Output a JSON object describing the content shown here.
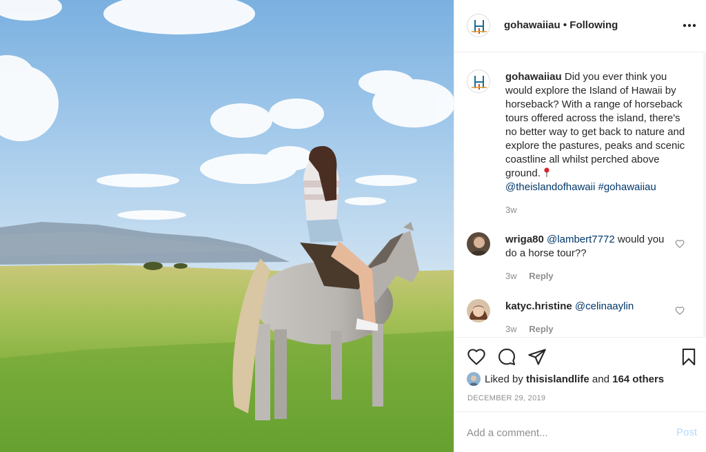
{
  "post": {
    "image_alt": "",
    "account": "gohawaiiau",
    "separator": "•",
    "follow_status": "Following",
    "more_icon": "more-dots-icon"
  },
  "caption": {
    "username": "gohawaiiau",
    "text": "Did you ever think you would explore the Island of Hawaii by horseback? With a range of horseback tours offered across the island, there's no better way to get back to nature and explore the pastures, peaks and scenic coastline all whilst perched above ground.",
    "emoji": "round-pushpin-icon",
    "mention": "@theislandofhawaii",
    "hashtag": "#gohawaiiau",
    "time": "3w"
  },
  "comments": [
    {
      "username": "wriga80",
      "mention": "@lambert7772",
      "text": "would you do a horse tour??",
      "time": "3w",
      "reply_label": "Reply"
    },
    {
      "username": "katyc.hristine",
      "mention": "@celinaaylin",
      "text": "",
      "time": "3w",
      "reply_label": "Reply"
    }
  ],
  "actions": {
    "icons": [
      "heart-icon",
      "comment-icon",
      "share-icon",
      "bookmark-icon"
    ],
    "liked_prefix": "Liked by",
    "liked_user": "thisislandlife",
    "liked_and": "and",
    "liked_others": "164 others",
    "date": "DECEMBER 29, 2019"
  },
  "add_comment": {
    "placeholder": "Add a comment...",
    "post_label": "Post"
  },
  "colors": {
    "text": "#262626",
    "muted": "#8e8e8e",
    "link": "#00376b",
    "post_disabled": "#b3dbff",
    "border": "#efefef"
  }
}
